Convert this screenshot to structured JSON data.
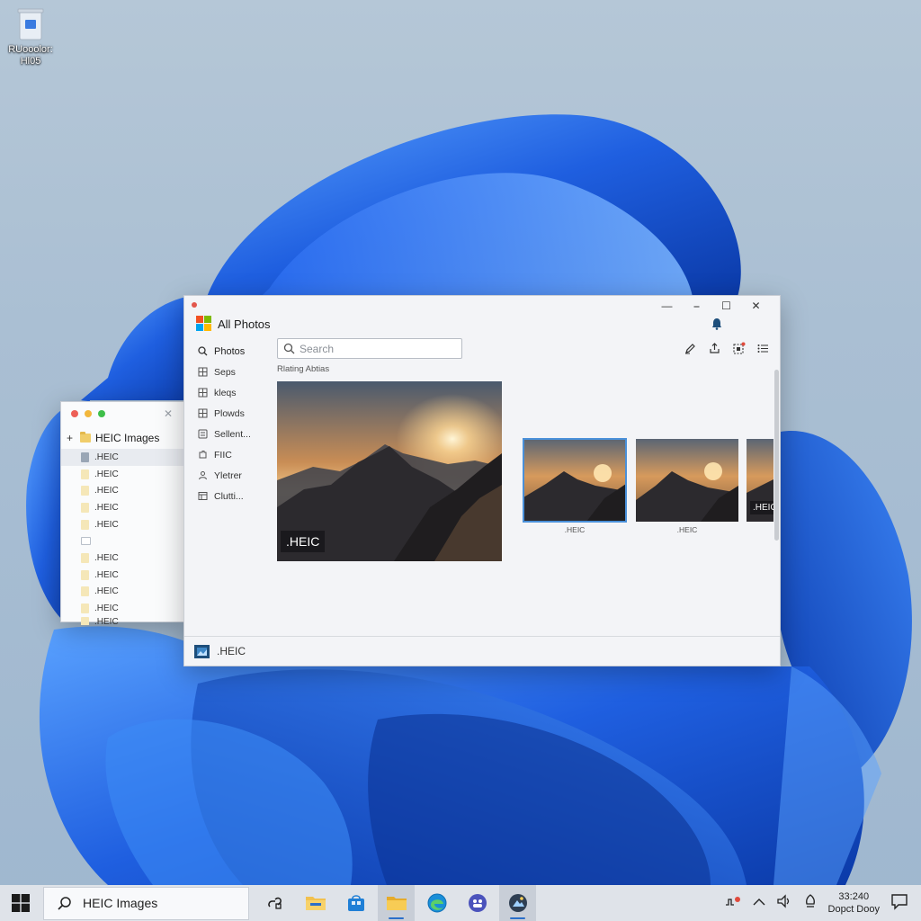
{
  "desktop": {
    "icon_label": "RUooolor: Hl05"
  },
  "explorer": {
    "title": "HEIC Images",
    "files": [
      ".HEIC",
      ".HEIC",
      ".HEIC",
      ".HEIC",
      ".HEIC",
      "",
      ".HEIC",
      ".HEIC",
      ".HEIC",
      ".HEIC",
      ".HEIC"
    ]
  },
  "photos": {
    "title": "All Photos",
    "search_placeholder": "Search",
    "nav": [
      {
        "label": "Photos",
        "icon": "search-icon"
      },
      {
        "label": "Seps",
        "icon": "grid-icon"
      },
      {
        "label": "kleqs",
        "icon": "grid-icon"
      },
      {
        "label": "Plowds",
        "icon": "grid-icon"
      },
      {
        "label": "Sellent...",
        "icon": "list-icon"
      },
      {
        "label": "FIIC",
        "icon": "puzzle-icon"
      },
      {
        "label": "Yletrer",
        "icon": "person-icon"
      },
      {
        "label": "Clutti...",
        "icon": "table-icon"
      }
    ],
    "section_label": "Rlating Abtias",
    "hero_badge": ".HEIC",
    "thumbnails": [
      {
        "label": ".HEIC",
        "selected": true
      },
      {
        "label": ".HEIC",
        "selected": false
      },
      {
        "label": ".HEIC",
        "selected": false
      }
    ],
    "footer_label": ".HEIC"
  },
  "taskbar": {
    "search_text": "HEIC Images",
    "time": "33:240",
    "date": "Dopct Dooy"
  },
  "colors": {
    "accent": "#2b6fc9",
    "wallpaper_blue": "#1f5fe0"
  }
}
